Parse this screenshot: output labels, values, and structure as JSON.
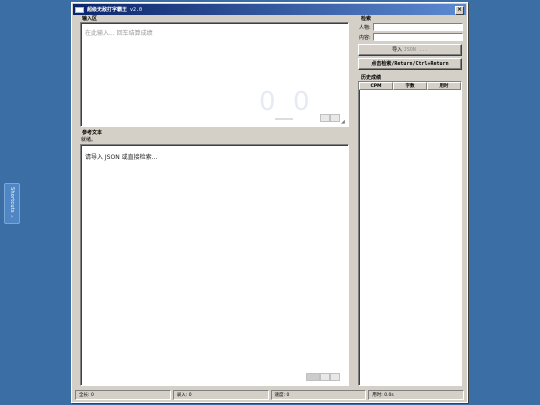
{
  "side_tab": {
    "label": "Shortcuts",
    "chevron": "›"
  },
  "window": {
    "title": "超级无敌打字霸王",
    "version": "v2.0",
    "close": "×"
  },
  "input_area": {
    "group_title": "输入区",
    "placeholder": "在此输入... 回车结算成绩",
    "score_left": "0",
    "score_right": "0"
  },
  "reference": {
    "group_title": "参考文本",
    "sub_label": "就绪。",
    "text": "请导入 JSON 或直接检索..."
  },
  "search": {
    "group_title": "检索",
    "person_label": "人物:",
    "content_label": "内容:",
    "person_value": "",
    "content_value": "",
    "import_label": "导入",
    "import_suffix": "JSON ...",
    "search_button": "点击检索/Return/Ctrl+Return"
  },
  "history": {
    "group_title": "历史成绩",
    "columns": [
      "CPM",
      "字数",
      "用时"
    ]
  },
  "status_bar": {
    "total": "全长: 0",
    "typed": "录入: 0",
    "speed": "速度: 0",
    "time": "用时: 0.0s"
  },
  "colors": {
    "desktop": "#3a6ea5",
    "window_face": "#d4d0c8",
    "title_start": "#0a246a",
    "title_end": "#5c8ad1"
  }
}
